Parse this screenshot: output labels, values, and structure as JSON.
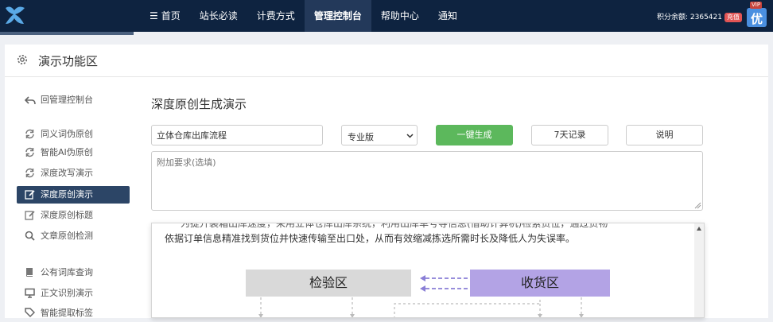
{
  "topnav": {
    "items": [
      {
        "label": "首页",
        "icon": "menu-icon"
      },
      {
        "label": "站长必读"
      },
      {
        "label": "计费方式"
      },
      {
        "label": "管理控制台",
        "active": true
      },
      {
        "label": "帮助中心"
      },
      {
        "label": "通知"
      }
    ],
    "points": "积分余额: 2365421",
    "recharge": "充值",
    "vip": "VIP",
    "vip_char": "优"
  },
  "panel": {
    "title": "演示功能区"
  },
  "sidebar": {
    "items": [
      {
        "label": "回管理控制台",
        "icon": "back-arrow-icon"
      },
      {
        "label": "同义词伪原创",
        "icon": "refresh-icon"
      },
      {
        "label": "智能AI伪原创",
        "icon": "refresh-icon"
      },
      {
        "label": "深度改写演示",
        "icon": "refresh-icon"
      },
      {
        "label": "深度原创演示",
        "icon": "edit-icon",
        "active": true
      },
      {
        "label": "深度原创标题",
        "icon": "edit-icon"
      },
      {
        "label": "文章原创检测",
        "icon": "search-icon"
      },
      {
        "label": "公有词库查询",
        "icon": "book-icon"
      },
      {
        "label": "正文识别演示",
        "icon": "monitor-icon"
      },
      {
        "label": "智能提取标签",
        "icon": "tag-icon"
      }
    ]
  },
  "main": {
    "title": "深度原创生成演示",
    "keyword_value": "立体仓库出库流程",
    "version_selected": "专业版",
    "generate_label": "一键生成",
    "history_label": "7天记录",
    "help_label": "说明",
    "requirements_placeholder": "附加要求(选填)"
  },
  "output": {
    "line1": "为提升装箱出库速度，采用立体仓库出库系统，利用出库单号等信息(借助计算机)检索货位，通过货物",
    "line2": "依据订单信息精准找到货位并快速传输至出口处，从而有效缩减拣选所需时长及降低人为失误率。",
    "box_check": "检验区",
    "box_receive": "收货区"
  },
  "colors": {
    "topbar": "#0e2340",
    "active_nav": "#23395a",
    "active_side": "#2c4566",
    "primary": "#5cb85c",
    "receive_box": "#b3a3e5",
    "check_box": "#d9d9d9"
  }
}
